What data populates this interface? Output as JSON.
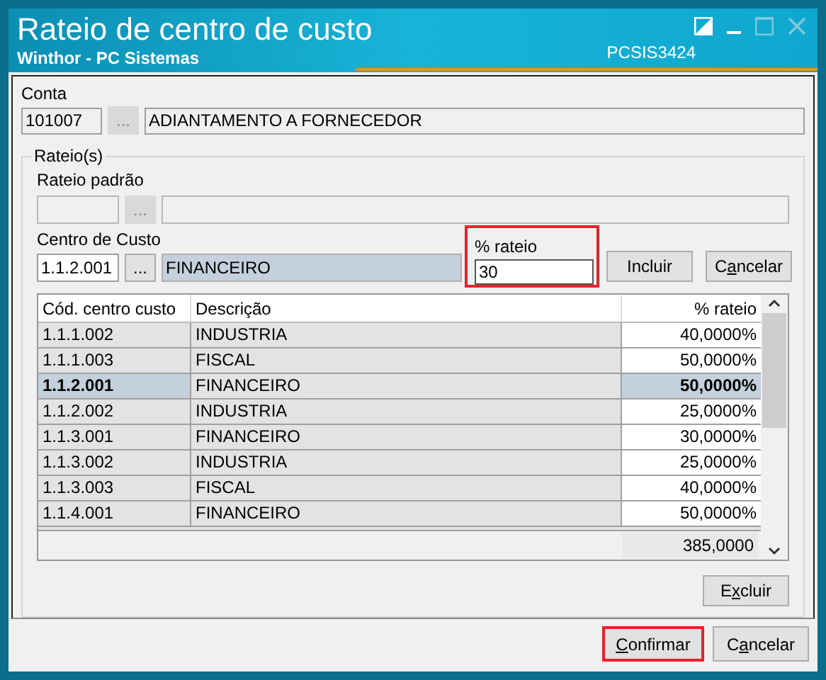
{
  "window": {
    "title": "Rateio de centro de custo",
    "subtitle": "Winthor - PC Sistemas",
    "code": "PCSIS3424"
  },
  "conta": {
    "label": "Conta",
    "code": "101007",
    "lookup": "...",
    "description": "ADIANTAMENTO A FORNECEDOR"
  },
  "rateios": {
    "group_title": "Rateio(s)",
    "rateio_padrao": {
      "label": "Rateio padrão",
      "lookup": "...",
      "disabled": true
    },
    "centro_de_custo": {
      "label": "Centro de Custo",
      "code": "1.1.2.001",
      "lookup": "...",
      "description": "FINANCEIRO"
    },
    "percent": {
      "label": "% rateio",
      "value": "30",
      "highlighted": true
    },
    "buttons": [
      {
        "label": {
          "before": "Incluir"
        }
      },
      {
        "label": {
          "before": "C",
          "key": "a",
          "after": "ncelar"
        }
      }
    ],
    "table": {
      "columns": [
        "Cód. centro custo",
        "Descrição",
        "% rateio"
      ],
      "rows": [
        {
          "code": "1.1.1.002",
          "description": "INDUSTRIA",
          "percent": "40,0000%",
          "selected": false
        },
        {
          "code": "1.1.1.003",
          "description": "FISCAL",
          "percent": "50,0000%",
          "selected": false
        },
        {
          "code": "1.1.2.001",
          "description": "FINANCEIRO",
          "percent": "50,0000%",
          "selected": true
        },
        {
          "code": "1.1.2.002",
          "description": "INDUSTRIA",
          "percent": "25,0000%",
          "selected": false
        },
        {
          "code": "1.1.3.001",
          "description": "FINANCEIRO",
          "percent": "30,0000%",
          "selected": false
        },
        {
          "code": "1.1.3.002",
          "description": "INDUSTRIA",
          "percent": "25,0000%",
          "selected": false
        },
        {
          "code": "1.1.3.003",
          "description": "FISCAL",
          "percent": "40,0000%",
          "selected": false
        },
        {
          "code": "1.1.4.001",
          "description": "FINANCEIRO",
          "percent": "50,0000%",
          "selected": false
        }
      ],
      "total": "385,0000"
    },
    "delete_button": {
      "label": {
        "before": "E",
        "key": "x",
        "after": "cluir"
      }
    }
  },
  "footer_buttons": [
    {
      "label": {
        "key": "C",
        "after": "onfirmar"
      },
      "highlighted": true
    },
    {
      "label": {
        "before": "C",
        "key": "a",
        "after": "ncelar"
      },
      "highlighted": false
    }
  ]
}
